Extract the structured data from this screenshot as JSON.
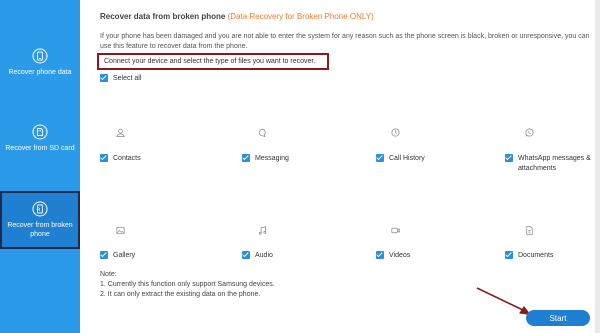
{
  "sidebar": {
    "items": [
      {
        "label": "Recover phone data",
        "icon": "phone-recover-icon"
      },
      {
        "label": "Recover from SD card",
        "icon": "sd-card-icon"
      },
      {
        "label": "Recover from broken phone",
        "icon": "broken-phone-icon",
        "active": true
      }
    ]
  },
  "main": {
    "title": "Recover data from broken phone",
    "title_note": "(Data Recovery for Broken Phone ONLY)",
    "description": "If your phone has been damaged and you are not able to enter the system for any reason such as the phone screen is black, broken or unresponsive, you can use this feature to recover data from the phone.",
    "instruction": "Connect your device and select the type of files you want to recover.",
    "select_all": "Select all",
    "file_types": [
      {
        "label": "Contacts",
        "icon": "person-icon"
      },
      {
        "label": "Messaging",
        "icon": "message-bubble-icon"
      },
      {
        "label": "Call History",
        "icon": "clock-icon"
      },
      {
        "label": "WhatsApp messages & attachments",
        "icon": "whatsapp-icon"
      },
      {
        "label": "Gallery",
        "icon": "image-icon"
      },
      {
        "label": "Audio",
        "icon": "music-note-icon"
      },
      {
        "label": "Videos",
        "icon": "video-icon"
      },
      {
        "label": "Documents",
        "icon": "document-icon"
      }
    ],
    "note_title": "Note:",
    "note_lines": [
      "1. Currently this function only support Samsung devices.",
      "2. It can only extract the existing data on the phone."
    ],
    "start_label": "Start"
  },
  "colors": {
    "sidebar": "#2b9ae8",
    "accent": "#1f7fd0",
    "highlight": "#f07d2a",
    "annotation": "#8b1a1a"
  }
}
